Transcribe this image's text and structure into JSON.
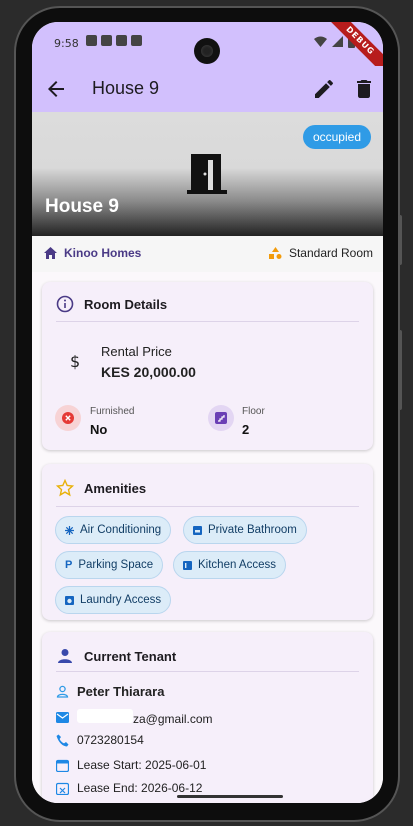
{
  "status_bar": {
    "time": "9:58"
  },
  "debug_banner": "DEBUG",
  "app_bar": {
    "title": "House 9"
  },
  "hero": {
    "status": "occupied",
    "title": "House 9"
  },
  "info": {
    "owner": "Kinoo Homes",
    "room_type": "Standard Room"
  },
  "room_details": {
    "title": "Room Details",
    "price_label": "Rental Price",
    "price_value": "KES 20,000.00",
    "furnished_label": "Furnished",
    "furnished_value": "No",
    "floor_label": "Floor",
    "floor_value": "2"
  },
  "amenities": {
    "title": "Amenities",
    "items": [
      "Air Conditioning",
      "Private Bathroom",
      "Parking Space",
      "Kitchen Access",
      "Laundry Access"
    ]
  },
  "tenant": {
    "title": "Current Tenant",
    "name": "Peter Thiarara",
    "email_visible": "za@gmail.com",
    "phone": "0723280154",
    "lease_start": "Lease Start: 2025-06-01",
    "lease_end": "Lease End: 2026-06-12"
  },
  "colors": {
    "app_bar": "#d2c0fd",
    "status_chip": "#2f9be6",
    "card_bg": "#f6effa",
    "chip_bg": "#dcecf8"
  }
}
